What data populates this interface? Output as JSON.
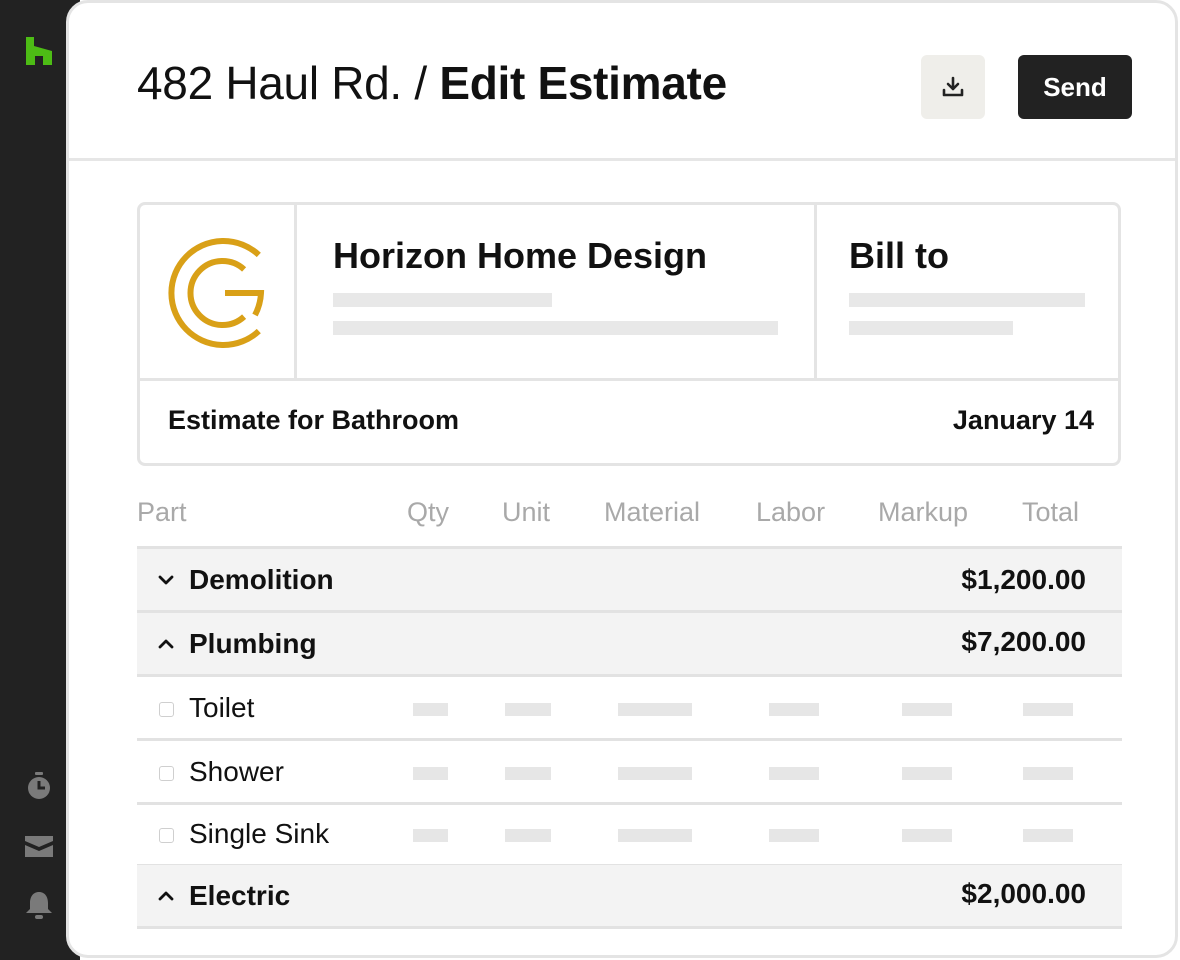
{
  "sidebar": {
    "logo_icon": "houzz-logo-icon",
    "brand_color": "#4dbc15",
    "bottom_icons": [
      "stopwatch-icon",
      "inbox-icon",
      "bell-icon"
    ]
  },
  "header": {
    "address": "482 Haul Rd. /",
    "title": "Edit Estimate",
    "download_icon": "download-icon",
    "send_label": "Send"
  },
  "card": {
    "logo_color": "#d9a017",
    "company_name": "Horizon Home Design",
    "bill_to_label": "Bill to",
    "estimate_for": "Estimate for Bathroom",
    "date": "January 14"
  },
  "table": {
    "columns": [
      "Part",
      "Qty",
      "Unit",
      "Material",
      "Labor",
      "Markup",
      "Total"
    ],
    "groups": [
      {
        "name": "Demolition",
        "total": "$1,200.00",
        "expanded": false,
        "items": []
      },
      {
        "name": "Plumbing",
        "total": "$7,200.00",
        "expanded": true,
        "items": [
          "Toilet",
          "Shower",
          "Single Sink"
        ]
      },
      {
        "name": "Electric",
        "total": "$2,000.00",
        "expanded": true,
        "items": []
      }
    ]
  }
}
